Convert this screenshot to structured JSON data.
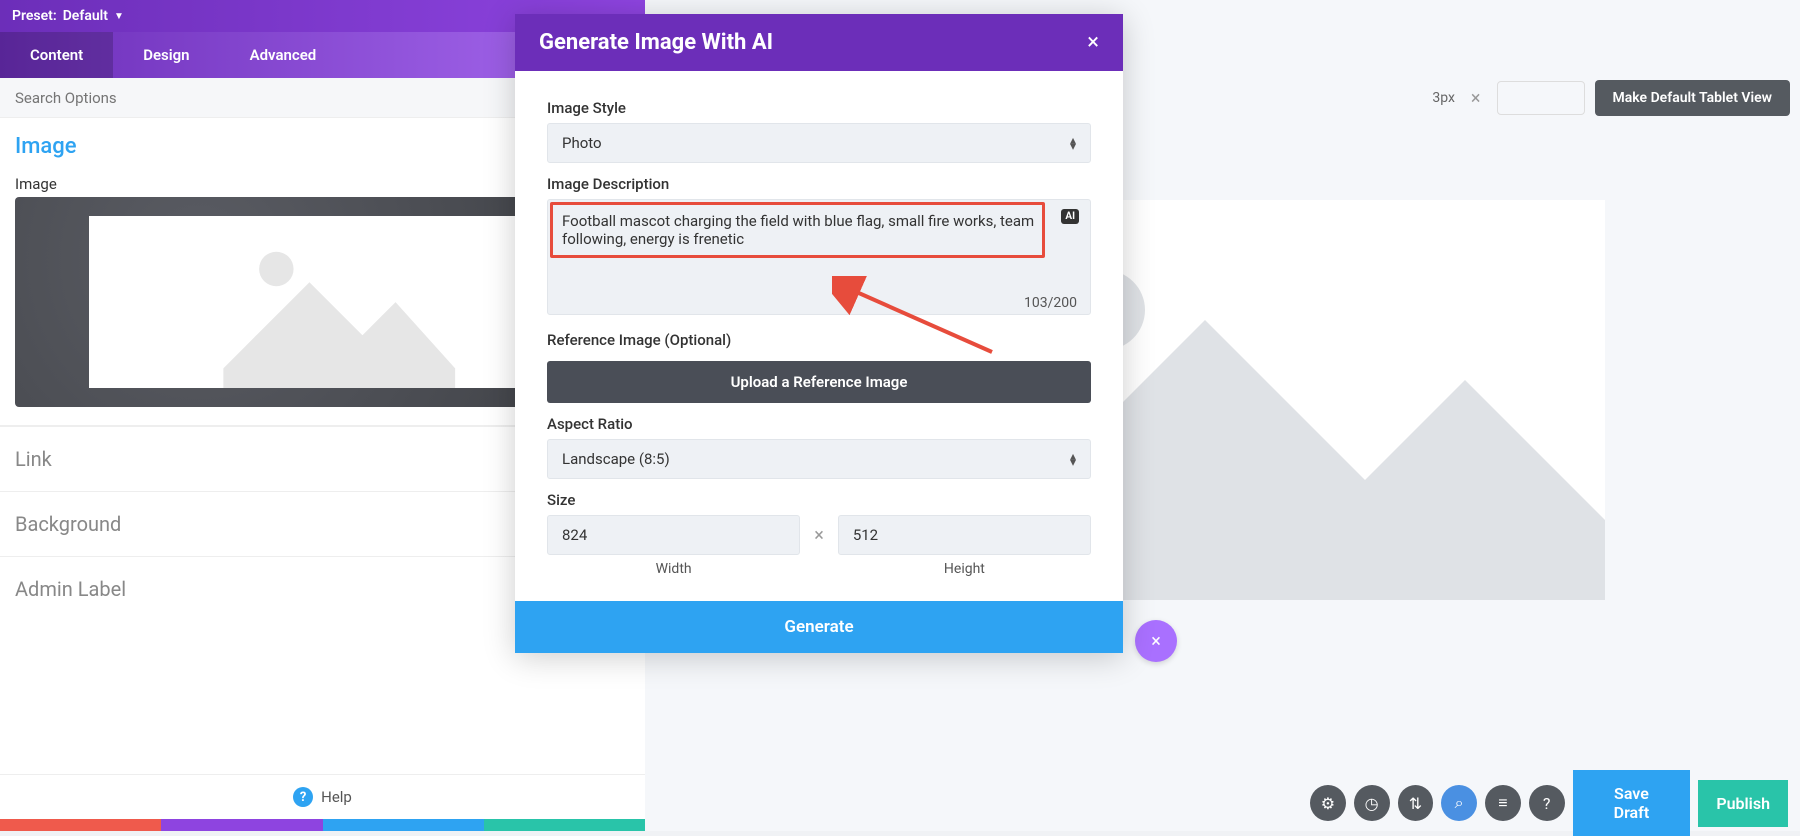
{
  "preset": {
    "label": "Preset:",
    "value": "Default"
  },
  "tabs": {
    "content": "Content",
    "design": "Design",
    "advanced": "Advanced"
  },
  "search": {
    "placeholder": "Search Options"
  },
  "sections": {
    "image_head": "Image",
    "image_label": "Image",
    "link": "Link",
    "background": "Background",
    "admin_label": "Admin Label"
  },
  "help": {
    "label": "Help"
  },
  "topbar": {
    "px_readout": "3px",
    "make_default": "Make Default Tablet View"
  },
  "builder": {
    "save_draft": "Save Draft",
    "publish": "Publish"
  },
  "modal": {
    "title": "Generate Image With AI",
    "image_style_label": "Image Style",
    "image_style_value": "Photo",
    "image_description_label": "Image Description",
    "image_description_value": "Football mascot charging the field with blue flag, small fire works, team following, energy is frenetic",
    "char_count": "103/200",
    "ai_badge": "AI",
    "reference_label": "Reference Image (Optional)",
    "upload_reference": "Upload a Reference Image",
    "aspect_ratio_label": "Aspect Ratio",
    "aspect_ratio_value": "Landscape (8:5)",
    "size_label": "Size",
    "width_value": "824",
    "height_value": "512",
    "width_caption": "Width",
    "height_caption": "Height",
    "generate": "Generate"
  }
}
